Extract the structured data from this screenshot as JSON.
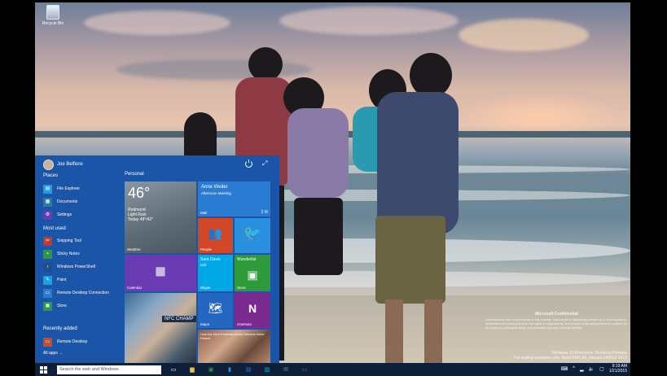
{
  "desktop": {
    "recycle_bin_label": "Recycle Bin",
    "confidential": {
      "title": "Microsoft Confidential",
      "body": "Unauthorized use or disclosure in any manner may result in disciplinary action up to and including termination of employment (in the case of employees), termination of an assignment or contract (in the case of contingent staff), and potential civil and criminal liability."
    },
    "build_line1": "Windows 10 Enterprise Technical Preview",
    "build_line2": "For testing purposes only. Build 9841.fbl_release.140912-1613"
  },
  "start_menu": {
    "user_name": "Joe Belfiore",
    "places_header": "Places",
    "places": [
      {
        "label": "File Explorer",
        "icon": "folder-icon",
        "color": "#1ba1e2"
      },
      {
        "label": "Documents",
        "icon": "documents-icon",
        "color": "#2d7d9a"
      },
      {
        "label": "Settings",
        "icon": "gear-icon",
        "color": "#6b3bb4"
      }
    ],
    "most_used_header": "Most used",
    "most_used": [
      {
        "label": "Snipping Tool",
        "icon": "scissors-icon",
        "color": "#c0392b"
      },
      {
        "label": "Sticky Notes",
        "icon": "sticky-note-icon",
        "color": "#2f9a3b"
      },
      {
        "label": "Windows PowerShell",
        "icon": "powershell-icon",
        "color": "#1f4e8c"
      },
      {
        "label": "Paint",
        "icon": "paint-icon",
        "color": "#1ba1e2"
      },
      {
        "label": "Remote Desktop Connection",
        "icon": "remote-desktop-icon",
        "color": "#2a7cd3"
      },
      {
        "label": "Store",
        "icon": "store-icon",
        "color": "#2f9a3b"
      }
    ],
    "recently_added_header": "Recently added",
    "recently_added": [
      {
        "label": "Remote Desktop",
        "icon": "remote-desktop-icon",
        "color": "#d24726"
      }
    ],
    "all_apps": "All apps →",
    "personal_header": "Personal",
    "tiles": {
      "weather": {
        "temp": "46°",
        "city": "Redmond",
        "condition": "Light Rain",
        "today": "Today 48°/42°",
        "label": "Weather"
      },
      "mail": {
        "from": "Anne Weiler",
        "subject": "Afternoon Meeting",
        "label": "Mail",
        "count": "2"
      },
      "people": {
        "label": "People"
      },
      "twitter": {
        "label": ""
      },
      "calendar": {
        "label": "Calendar"
      },
      "skype": {
        "from": "Sara Davis",
        "status": "call",
        "label": "Skype"
      },
      "store": {
        "label": "Store",
        "caption": "Wunderlist"
      },
      "photos": {
        "caption": "NFC CHAMP"
      },
      "maps": {
        "label": "Maps"
      },
      "onenote": {
        "label": "OneNote"
      },
      "news": {
        "caption": "How the Next Emerald Award Winners Were Picked"
      }
    }
  },
  "taskbar": {
    "search_placeholder": "Search the web and Windows",
    "time": "9:19 AM",
    "date": "1/21/2015"
  }
}
